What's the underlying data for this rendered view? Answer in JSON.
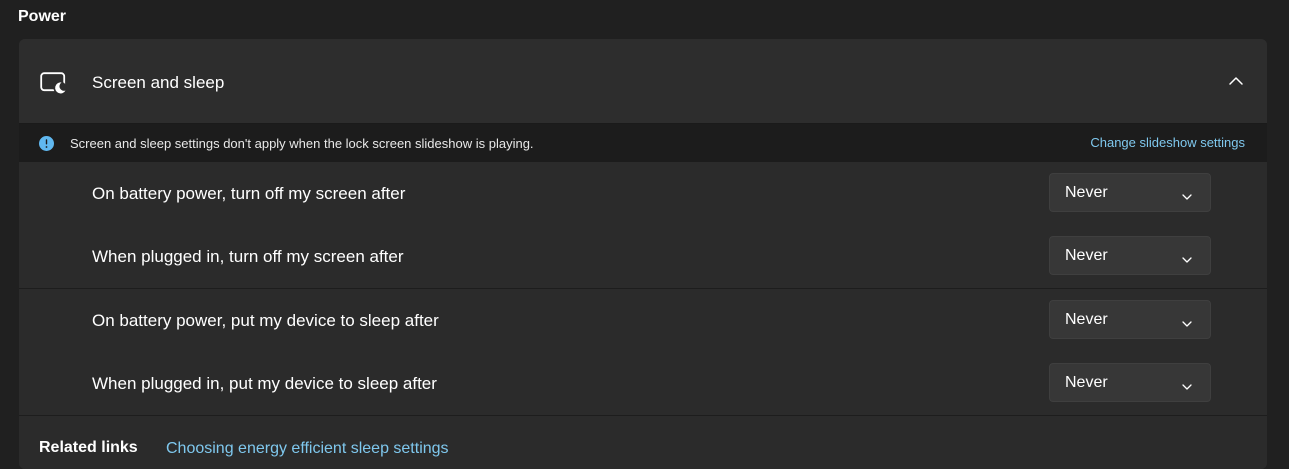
{
  "section": {
    "title": "Power"
  },
  "screen_sleep": {
    "header_label": "Screen and sleep",
    "expanded": true,
    "info": {
      "text": "Screen and sleep settings don't apply when the lock screen slideshow is playing.",
      "link": "Change slideshow settings"
    },
    "settings": [
      {
        "label": "On battery power, turn off my screen after",
        "value": "Never"
      },
      {
        "label": "When plugged in, turn off my screen after",
        "value": "Never"
      },
      {
        "label": "On battery power, put my device to sleep after",
        "value": "Never"
      },
      {
        "label": "When plugged in, put my device to sleep after",
        "value": "Never"
      }
    ]
  },
  "related": {
    "title": "Related links",
    "link": "Choosing energy efficient sleep settings"
  },
  "colors": {
    "background": "#202020",
    "card": "#2b2b2b",
    "accent_link": "#7fc8ee",
    "info_icon": "#60b8f0"
  },
  "icons": {
    "header": "screen-sleep-icon",
    "collapse": "chevron-up-icon",
    "info": "info-icon",
    "dropdown": "chevron-down-icon"
  }
}
